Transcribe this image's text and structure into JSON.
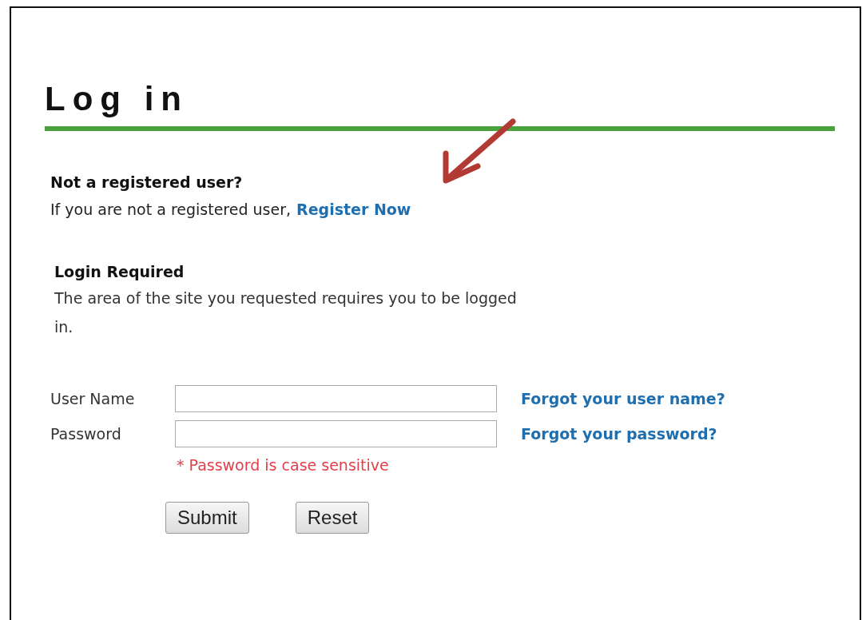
{
  "title": "Log in",
  "register": {
    "heading": "Not a registered user?",
    "text": "If you are not a registered user,",
    "link": "Register Now"
  },
  "notice": {
    "heading": "Login Required",
    "text": "The area of the site you requested requires you to be logged in."
  },
  "fields": [
    {
      "label": "User Name",
      "link": "Forgot your user name?"
    },
    {
      "label": "Password",
      "link": "Forgot your password?"
    }
  ],
  "hint": "* Password is case sensitive",
  "buttons": [
    "Submit",
    "Reset"
  ]
}
